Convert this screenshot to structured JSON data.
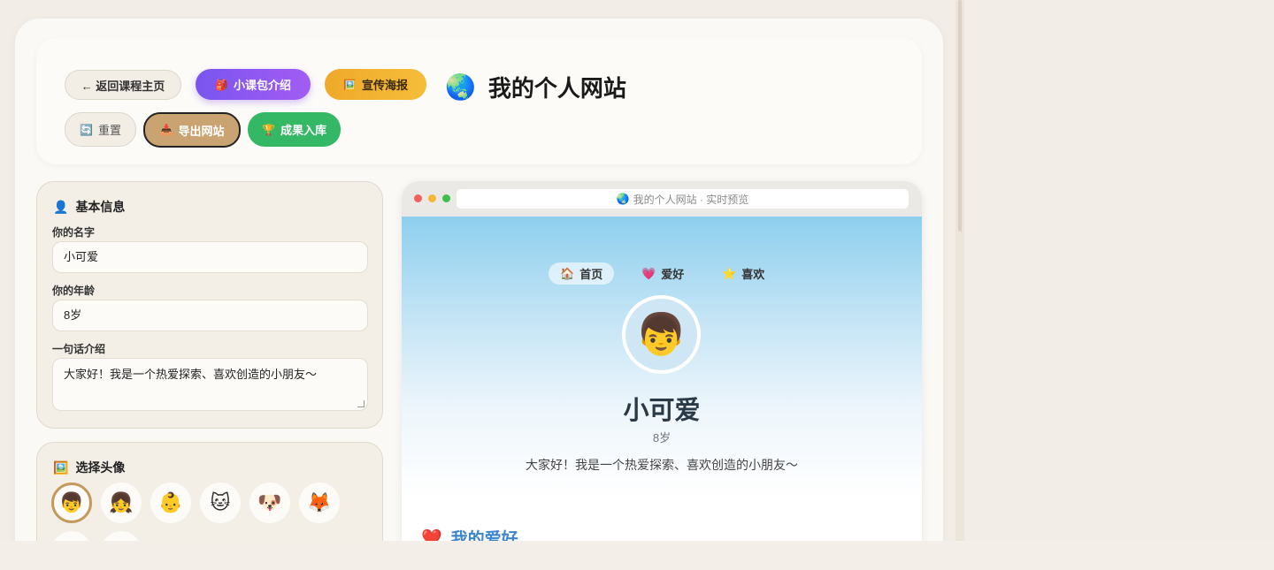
{
  "header": {
    "back_label": "← 返回课程主页",
    "intro_label": "小课包介绍",
    "poster_label": "宣传海报",
    "site_title": "我的个人网站",
    "reset_label": "重置",
    "export_label": "导出网站",
    "save_label": "成果入库"
  },
  "basic_info": {
    "title": "基本信息",
    "name_label": "你的名字",
    "name_value": "小可爱",
    "age_label": "你的年龄",
    "age_value": "8岁",
    "bio_label": "一句话介绍",
    "bio_value": "大家好！我是一个热爱探索、喜欢创造的小朋友～"
  },
  "avatar_picker": {
    "title": "选择头像",
    "options": [
      "👦",
      "👧",
      "👶",
      "🐱",
      "🐶",
      "🦊"
    ],
    "selected_index": 0
  },
  "preview": {
    "url_text": "我的个人网站 · 实时预览",
    "nav": [
      {
        "icon": "🏠",
        "label": "首页"
      },
      {
        "icon": "💗",
        "label": "爱好"
      },
      {
        "icon": "⭐",
        "label": "喜欢"
      }
    ],
    "avatar": "👦",
    "name": "小可爱",
    "age": "8岁",
    "bio": "大家好！我是一个热爱探索、喜欢创造的小朋友～",
    "section_title": "我的爱好"
  },
  "colors": {
    "accent_purple": "#7a55f0",
    "accent_orange": "#f0a92a",
    "accent_green": "#35b866",
    "export_tan": "#c9a472",
    "section_blue": "#3b86c9"
  }
}
